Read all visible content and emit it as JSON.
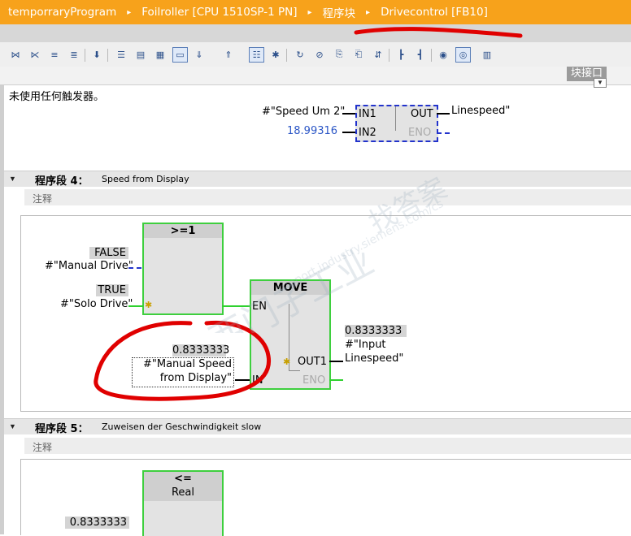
{
  "breadcrumb": {
    "items": [
      "temporraryProgram",
      "Foilroller [CPU 1510SP-1 PN]",
      "程序块",
      "Drivecontrol [FB10]"
    ],
    "separator": "▸"
  },
  "interface_label": "块接口",
  "interface_arrow": "▼",
  "network3": {
    "comment_tail": "未使用任何触发器。",
    "in1_operand": "#\"Speed Um 2\"",
    "in1": "IN1",
    "in2_value": "18.99316",
    "in2": "IN2",
    "out": "OUT",
    "out_operand": "Linespeed\"",
    "eno": "ENO"
  },
  "network4": {
    "title": "程序段 4：",
    "description": "Speed from Display",
    "comment_placeholder": "注释",
    "or_box": {
      "title": ">=1"
    },
    "false_value": "FALSE",
    "manual_drive": "#\"Manual Drive\"",
    "true_value": "TRUE",
    "solo_drive": "#\"Solo Drive\"",
    "move_box": {
      "title": "MOVE",
      "en": "EN",
      "in": "IN",
      "out1": "OUT1",
      "eno": "ENO"
    },
    "in_value": "0.8333333",
    "in_operand_line1": "#\"Manual Speed",
    "in_operand_line2": "from Display\"",
    "out_value": "0.8333333",
    "out_operand_line1": "#\"Input",
    "out_operand_line2": "Linespeed\""
  },
  "network5": {
    "title": "程序段 5：",
    "description": "Zuweisen der Geschwindigkeit slow",
    "comment_placeholder": "注释",
    "cmp_box": {
      "title": "<=",
      "type": "Real"
    },
    "value_partial": "0.8333333"
  },
  "toolbar_icons": [
    "insert-network-icon",
    "delete-network-icon",
    "insert-row-icon",
    "add-row-icon",
    "download-icon",
    "absolute-address-icon",
    "symbolic-address-icon",
    "symbol-info-icon",
    "comment-icon",
    "open-all-networks-icon",
    "close-all-networks-icon",
    "monitor-box-icon",
    "favorites-icon",
    "star-icon",
    "go-to-error-icon",
    "go-to-next-error-icon",
    "call-icon",
    "return-icon",
    "compare-icon",
    "branch-icon",
    "close-branch-icon",
    "monitor-icon",
    "monitoring-glasses-icon",
    "plc-tag-icon"
  ],
  "colors": {
    "breadcrumb_bg": "#f7a21b",
    "box_border": "#3ecf3e",
    "wire": "#2fd12f",
    "dashed": "#2233cc",
    "value_blue": "#2b56c6",
    "annotation_red": "#e00000"
  }
}
